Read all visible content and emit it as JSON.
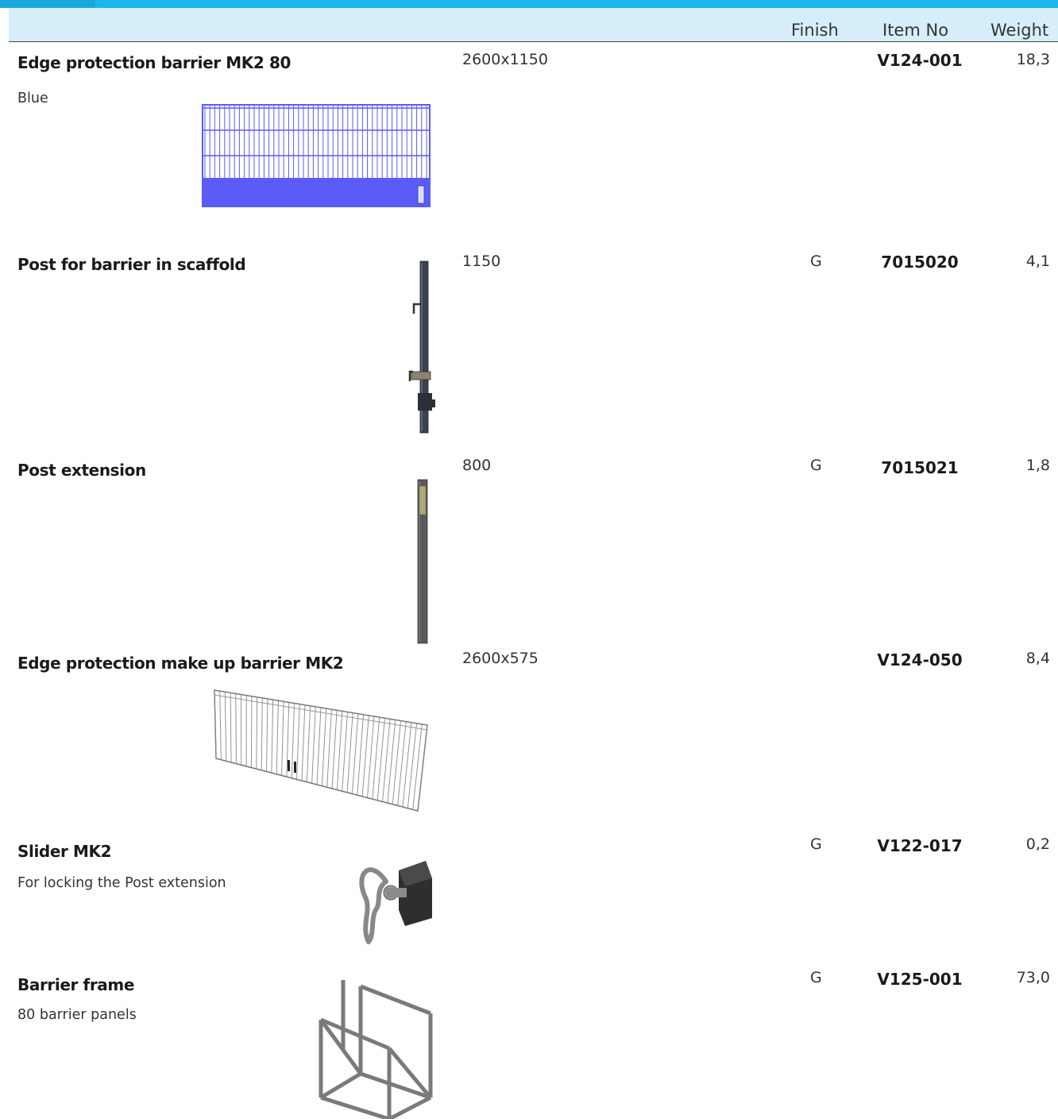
{
  "columns": {
    "finish": "Finish",
    "item_no": "Item No",
    "weight": "Weight"
  },
  "colors": {
    "header_bar": "#1fb6ea",
    "header_bg": "#d6eefa",
    "barrier_blue": "#5a5cf5"
  },
  "products": [
    {
      "name": "Edge protection barrier MK2 80",
      "description": "Blue",
      "dimension": "2600x1150",
      "finish": "",
      "item_no": "V124-001",
      "weight": "18,3",
      "image": "blue-barrier-image"
    },
    {
      "name": "Post for barrier in scaffold",
      "description": "",
      "dimension": "1150",
      "finish": "G",
      "item_no": "7015020",
      "weight": "4,1",
      "image": "post-image"
    },
    {
      "name": "Post extension",
      "description": "",
      "dimension": "800",
      "finish": "G",
      "item_no": "7015021",
      "weight": "1,8",
      "image": "post-extension-image"
    },
    {
      "name": "Edge protection make up barrier MK2",
      "description": "",
      "dimension": "2600x575",
      "finish": "",
      "item_no": "V124-050",
      "weight": "8,4",
      "image": "make-up-barrier-image"
    },
    {
      "name": "Slider MK2",
      "description": "For locking the Post extension",
      "dimension": "",
      "finish": "G",
      "item_no": "V122-017",
      "weight": "0,2",
      "image": "slider-image"
    },
    {
      "name": "Barrier frame",
      "description": "80 barrier panels",
      "dimension": "",
      "finish": "G",
      "item_no": "V125-001",
      "weight": "73,0",
      "image": "barrier-frame-image"
    }
  ]
}
